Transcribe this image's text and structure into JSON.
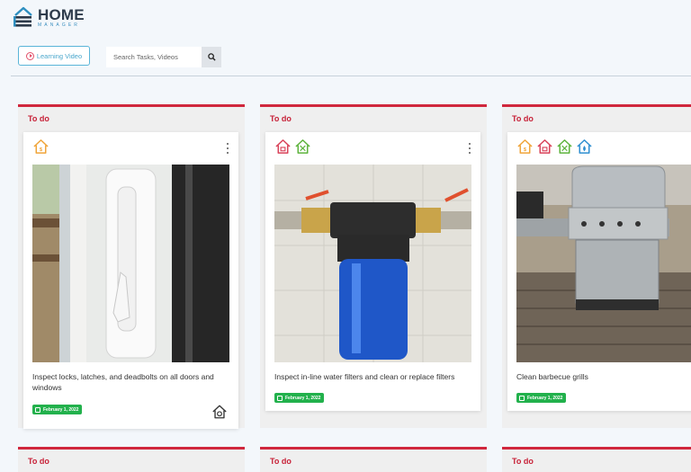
{
  "app": {
    "logo_main": "HOME",
    "logo_sub": "MANAGER"
  },
  "toolbar": {
    "learning_video_label": "Learning Video",
    "search_placeholder": "Search Tasks, Videos"
  },
  "columns": [
    {
      "header": "To do",
      "card": {
        "title": "Inspect locks, latches, and deadbolts on all doors and windows",
        "date": "February 1, 2022",
        "category_icons": [
          "house-orange"
        ],
        "image": "door-lock-photo"
      }
    },
    {
      "header": "To do",
      "card": {
        "title": "Inspect in-line water filters and clean or replace filters",
        "date": "February 1, 2022",
        "category_icons": [
          "house-red",
          "house-green-tools"
        ],
        "image": "water-filter-photo"
      }
    },
    {
      "header": "To do",
      "card": {
        "title": "Clean barbecue grills",
        "date": "February 1, 2022",
        "category_icons": [
          "house-orange",
          "house-red",
          "house-green-tools",
          "house-blue-drop"
        ],
        "image": "barbecue-grill-photo"
      }
    }
  ],
  "bottom_columns": [
    {
      "header": "To do"
    },
    {
      "header": "To do"
    },
    {
      "header": "To do"
    }
  ],
  "colors": {
    "accent_red": "#d0273d",
    "badge_green": "#22b14c",
    "link_blue": "#4aa7cc",
    "background": "#f3f7fb"
  }
}
